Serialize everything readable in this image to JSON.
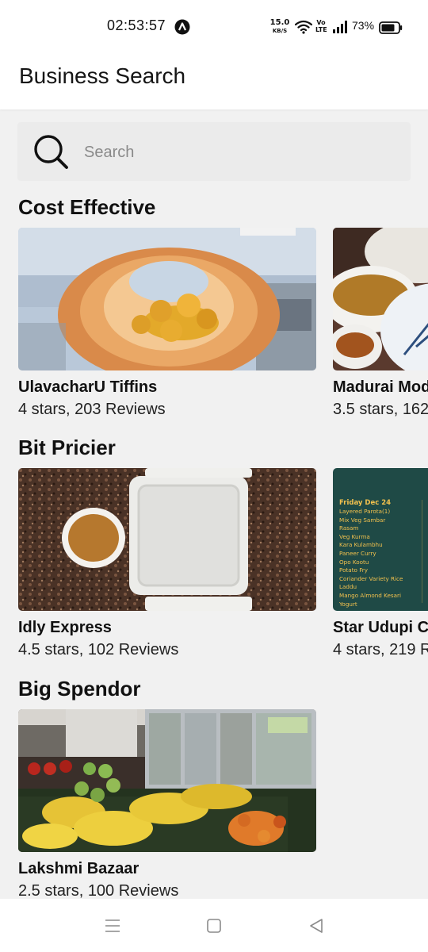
{
  "status_bar": {
    "time": "02:53:57",
    "net_speed_value": "15.0",
    "net_speed_unit": "KB/S",
    "volte_top": "Vo",
    "volte_bottom": "LTE",
    "battery": "73%",
    "icons": [
      "a-app-icon",
      "wifi-icon",
      "signal-icon",
      "battery-icon"
    ]
  },
  "app_bar": {
    "title": "Business Search"
  },
  "search": {
    "placeholder": "Search",
    "icon": "search-icon"
  },
  "sections": [
    {
      "title": "Cost Effective",
      "cards": [
        {
          "name": "UlavacharU Tiffins",
          "meta": "4 stars, 203 Reviews"
        },
        {
          "name": "Madurai Mod",
          "meta": "3.5 stars, 162"
        }
      ]
    },
    {
      "title": "Bit Pricier",
      "cards": [
        {
          "name": "Idly Express",
          "meta": "4.5 stars, 102 Reviews"
        },
        {
          "name": "Star Udupi Ca",
          "meta": "4 stars, 219 R"
        }
      ]
    },
    {
      "title": "Big Spendor",
      "cards": [
        {
          "name": "Lakshmi Bazaar",
          "meta": "2.5 stars, 100 Reviews"
        }
      ]
    }
  ],
  "menu_board": {
    "date": "Friday Dec 24",
    "items": [
      "Layered Parota(1)",
      "Mix Veg Sambar",
      "Rasam",
      "Veg Kurma",
      "Kara Kulambhu",
      "Paneer Curry",
      "Opo Kootu",
      "Potato Fry",
      "Coriander Variety Rice",
      "Laddu",
      "Mango Almond Kesari",
      "Yogurt"
    ]
  },
  "nav_bar": {
    "icons": [
      "menu-icon",
      "home-icon",
      "back-icon"
    ]
  },
  "colors": {
    "accent_text": "#111111",
    "surface": "#f1f1f1",
    "search_bg": "#ebebeb",
    "menu_board_bg": "#1f4a46",
    "menu_board_text": "#f2c14e"
  }
}
